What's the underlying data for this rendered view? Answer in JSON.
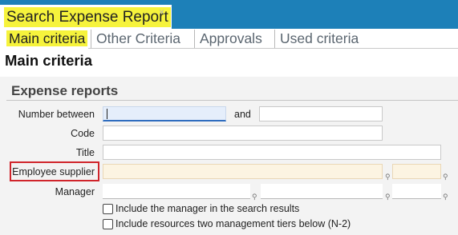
{
  "window": {
    "title": "Search Expense Report",
    "close_icon": "×"
  },
  "tabs": [
    {
      "label": "Main criteria",
      "active": true
    },
    {
      "label": "Other Criteria",
      "active": false
    },
    {
      "label": "Approvals",
      "active": false
    },
    {
      "label": "Used criteria",
      "active": false
    }
  ],
  "page": {
    "title": "Main criteria"
  },
  "section": {
    "title": "Expense reports"
  },
  "form": {
    "number_between": {
      "label": "Number between",
      "from_value": "",
      "to_value": "",
      "and_label": "and"
    },
    "code": {
      "label": "Code",
      "value": ""
    },
    "title": {
      "label": "Title",
      "value": ""
    },
    "employee_supplier": {
      "label": "Employee supplier",
      "value": "",
      "value2": "",
      "pin_icon": "pin-icon"
    },
    "manager": {
      "label": "Manager",
      "value": "",
      "value2": "",
      "value3": "",
      "pin_icon": "pin-icon"
    },
    "include_manager": {
      "label": "Include the manager in the search results",
      "checked": false
    },
    "include_n2": {
      "label": "Include resources two management tiers below (N-2)",
      "checked": false
    }
  },
  "colors": {
    "titlebar": "#1d80b8",
    "highlight": "#f6f33c",
    "annotation_box": "#d0242b",
    "lookup_field": "#fcf4e2"
  }
}
